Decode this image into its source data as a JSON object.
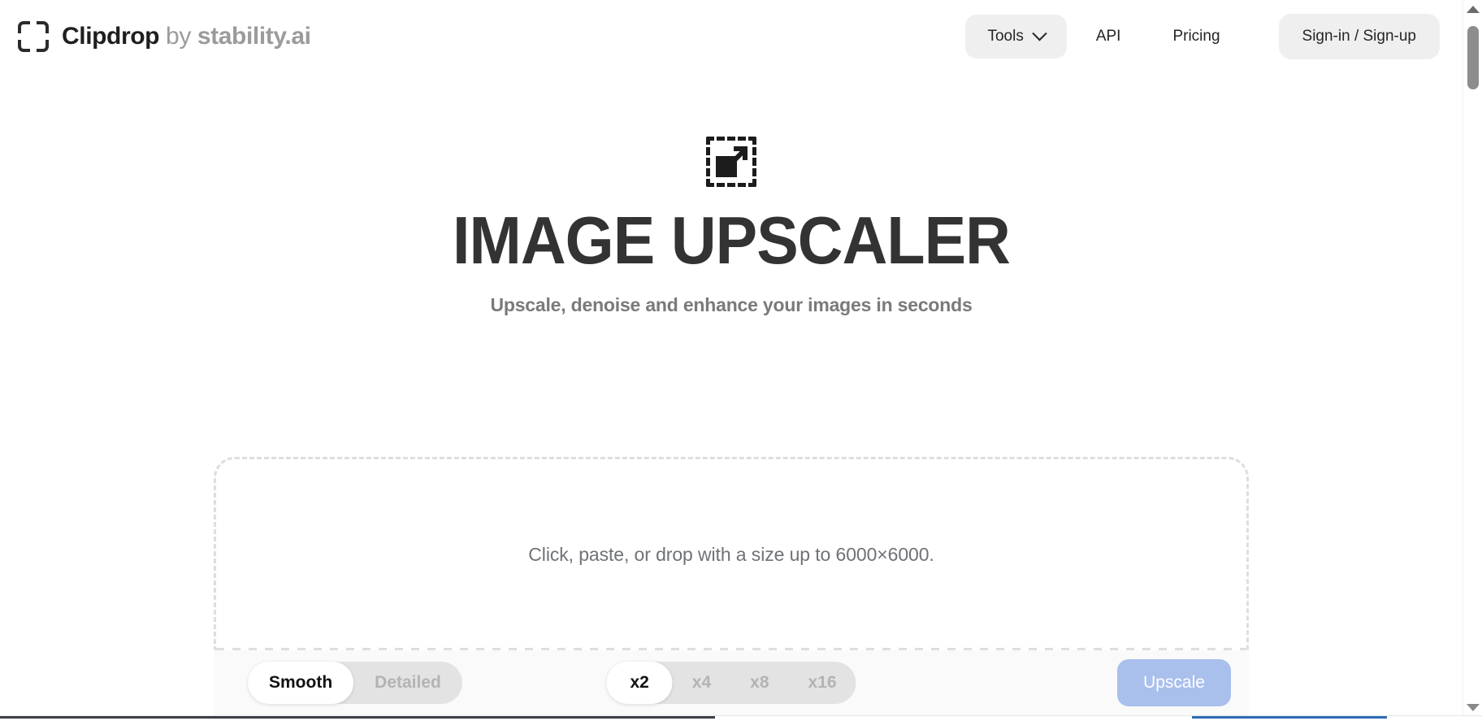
{
  "brand": {
    "logo_icon": "clipdrop-brackets-icon",
    "name": "Clipdrop",
    "by": " by ",
    "company": "stability.ai"
  },
  "nav": {
    "tools_label": "Tools",
    "tools_chevron_icon": "chevron-down-icon",
    "api_label": "API",
    "pricing_label": "Pricing",
    "auth_label": "Sign-in / Sign-up"
  },
  "hero": {
    "icon": "image-upscale-icon",
    "title": "IMAGE UPSCALER",
    "subtitle": "Upscale, denoise and enhance your images in seconds"
  },
  "uploader": {
    "dropzone_text": "Click, paste, or drop with a size up to 6000×6000.",
    "max_size": "6000×6000"
  },
  "toolbar": {
    "mode_options": [
      {
        "label": "Smooth",
        "selected": true
      },
      {
        "label": "Detailed",
        "selected": false
      }
    ],
    "scale_options": [
      {
        "label": "x2",
        "selected": true
      },
      {
        "label": "x4",
        "selected": false
      },
      {
        "label": "x8",
        "selected": false
      },
      {
        "label": "x16",
        "selected": false
      }
    ],
    "upscale_label": "Upscale",
    "upscale_enabled": false
  },
  "colors": {
    "accent_disabled": "#a9bfec",
    "pill_bg": "#efeff0",
    "segment_track": "#e3e3e3",
    "toolbar_bg": "#fafafa",
    "dropzone_border": "#dedede",
    "title_text": "#333333",
    "muted_text": "#7a7a7a"
  },
  "scrollbar": {
    "up_arrow_icon": "scroll-up-arrow-icon",
    "down_arrow_icon": "scroll-down-arrow-icon"
  }
}
